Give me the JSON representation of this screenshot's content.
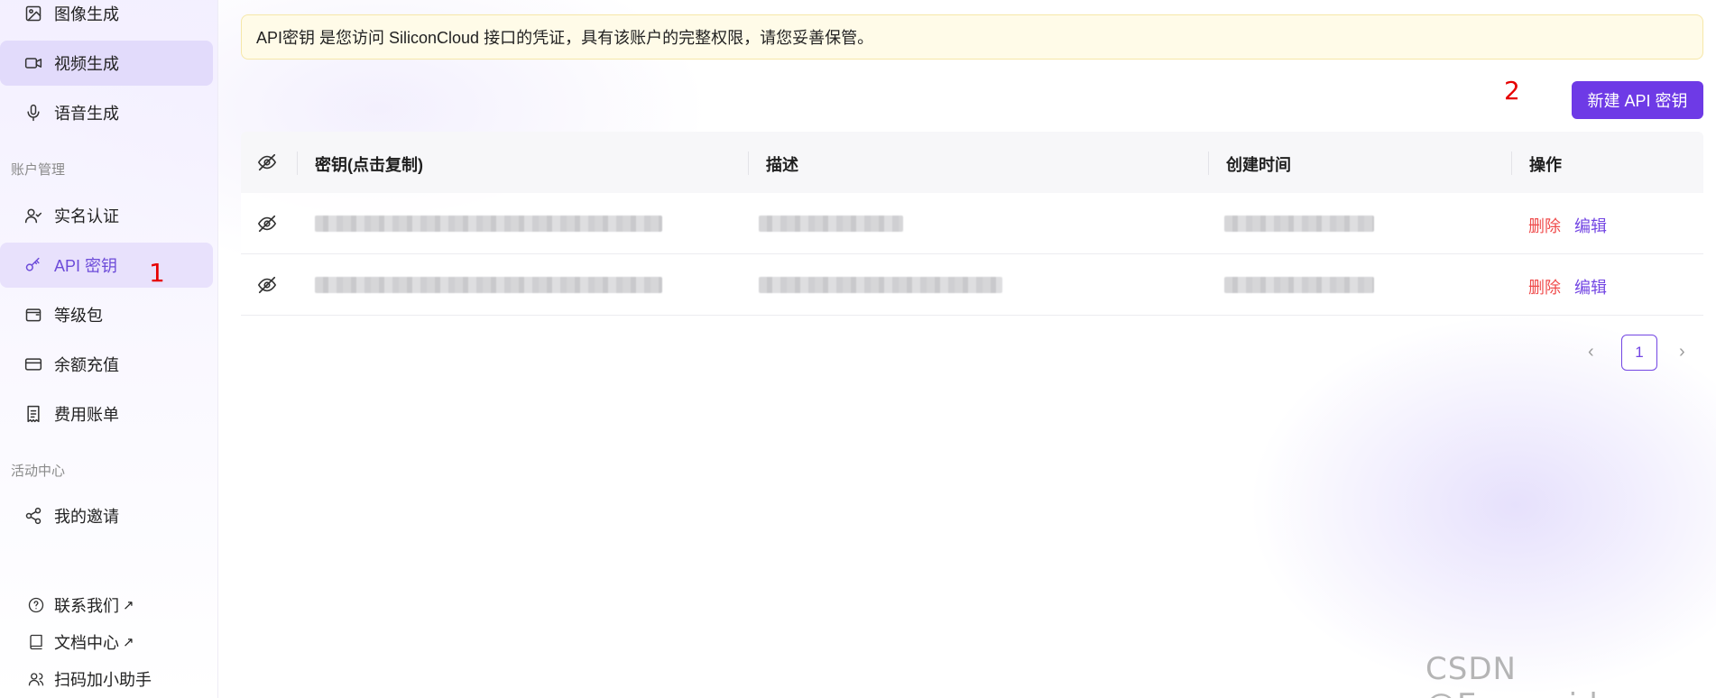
{
  "sidebar": {
    "items_top": [
      {
        "label": "图像生成",
        "icon": "image-icon"
      },
      {
        "label": "视频生成",
        "icon": "video-icon"
      },
      {
        "label": "语音生成",
        "icon": "microphone-icon"
      }
    ],
    "section_account": "账户管理",
    "items_account": [
      {
        "label": "实名认证",
        "icon": "user-check-icon"
      },
      {
        "label": "API 密钥",
        "icon": "key-icon"
      },
      {
        "label": "等级包",
        "icon": "wallet-icon"
      },
      {
        "label": "余额充值",
        "icon": "credit-card-icon"
      },
      {
        "label": "费用账单",
        "icon": "bill-icon"
      }
    ],
    "section_activity": "活动中心",
    "items_activity": [
      {
        "label": "我的邀请",
        "icon": "share-icon"
      }
    ],
    "footer": [
      {
        "label": "联系我们",
        "arrow": "↗",
        "icon": "help-circle-icon"
      },
      {
        "label": "文档中心",
        "arrow": "↗",
        "icon": "book-icon"
      },
      {
        "label": "扫码加小助手",
        "arrow": "",
        "icon": "users-icon"
      }
    ]
  },
  "annotations": {
    "marker_1": "1",
    "marker_2": "2"
  },
  "notice": "API密钥 是您访问 SiliconCloud 接口的凭证，具有该账户的完整权限，请您妥善保管。",
  "new_key_button": "新建 API 密钥",
  "table": {
    "headers": {
      "key": "密钥(点击复制)",
      "description": "描述",
      "created": "创建时间",
      "actions": "操作"
    },
    "row_actions": {
      "delete": "删除",
      "edit": "编辑"
    },
    "rows": 2
  },
  "pagination": {
    "current_page": "1",
    "prev": "‹",
    "next": "›"
  },
  "watermark": "CSDN @Eumenidus",
  "colors": {
    "accent": "#6e3ae6",
    "danger": "#ef4b4b",
    "notice_bg": "#fffbe8"
  }
}
